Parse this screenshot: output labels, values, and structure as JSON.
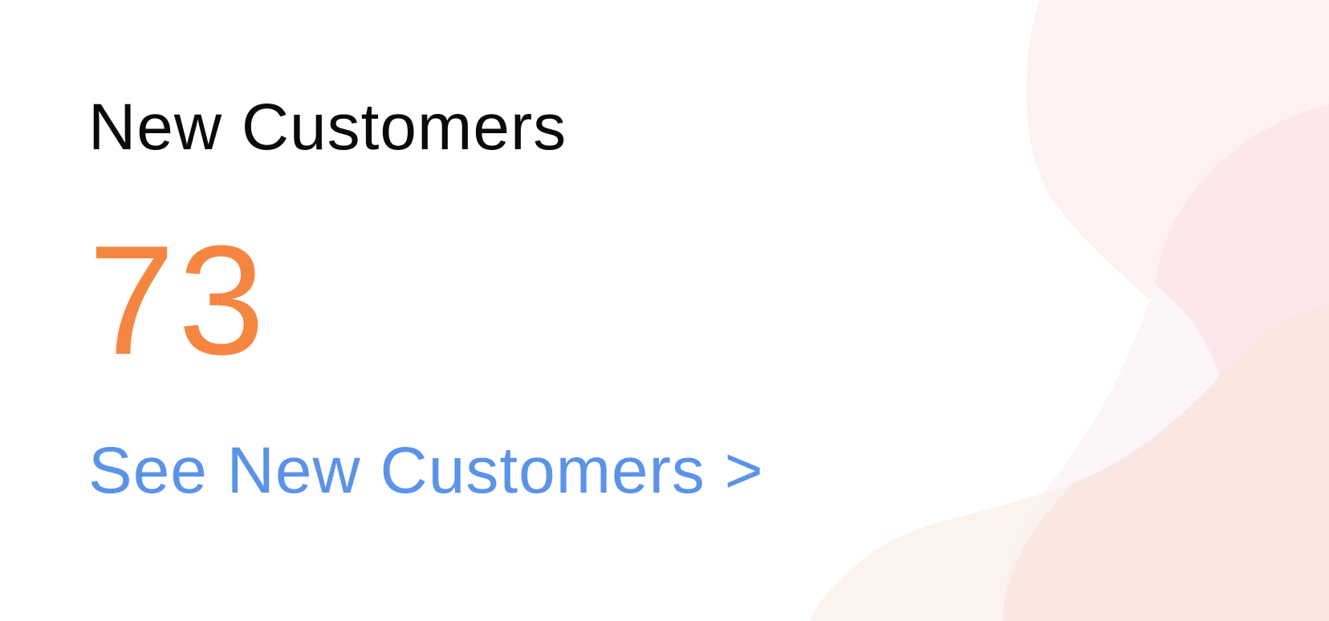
{
  "card": {
    "title": "New Customers",
    "count": "73",
    "link_label": "See New Customers >"
  },
  "colors": {
    "title": "#0a0a0a",
    "count": "#f58642",
    "link": "#5b93e8",
    "blob_pink_light": "#fdeff0",
    "blob_pink": "#fce6ea",
    "blob_peach": "#fbe6df",
    "blob_cream": "#fcf2eb",
    "blob_lavender": "#fcf5fb"
  }
}
